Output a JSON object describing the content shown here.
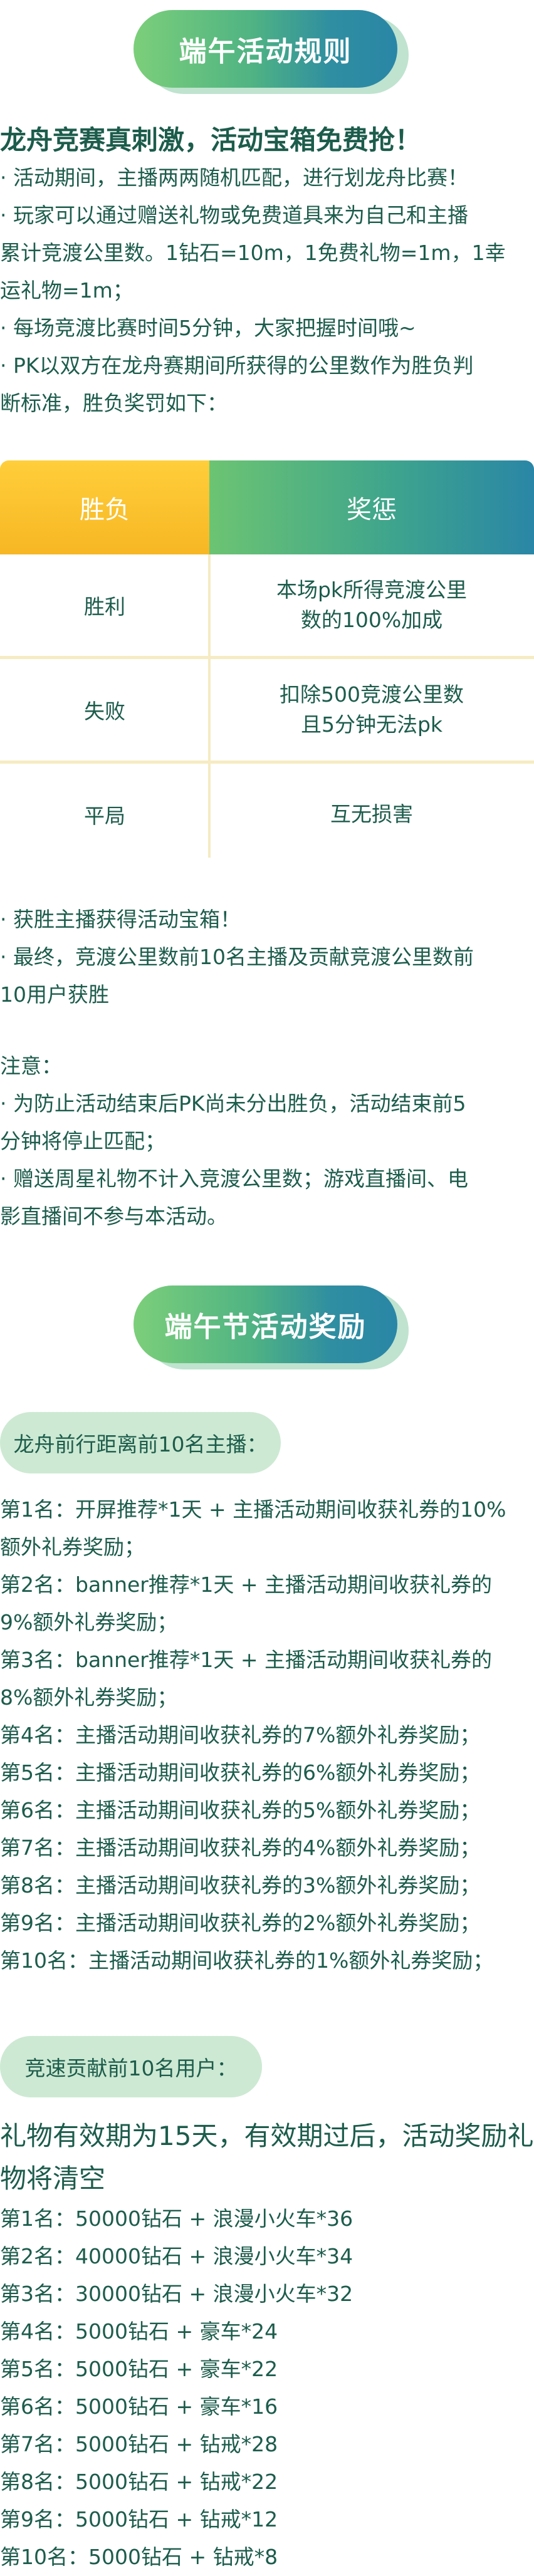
{
  "rules_title": "端午活动规则",
  "intro_heading": "龙舟竞赛真刺激，活动宝箱免费抢！",
  "rules": [
    {
      "l1": "· 活动期间，主播两两随机匹配，进行划龙舟比赛！"
    },
    {
      "l1": "· 玩家可以通过赠送礼物或免费道具来为自己和主播",
      "l2": "累计竞渡公里数。1钻石=10m，1免费礼物=1m，1幸",
      "l3": "运礼物=1m；"
    },
    {
      "l1": "· 每场竞渡比赛时间5分钟，大家把握时间哦~"
    },
    {
      "l1": "· PK以双方在龙舟赛期间所获得的公里数作为胜负判",
      "l2": "断标准，胜负奖罚如下："
    }
  ],
  "table": {
    "header_left": "胜负",
    "header_right": "奖惩",
    "rows": [
      {
        "result": "胜利",
        "reward_l1": "本场pk所得竞渡公里",
        "reward_l2": "数的100%加成"
      },
      {
        "result": "失败",
        "reward_l1": "扣除500竞渡公里数",
        "reward_l2": "且5分钟无法pk"
      },
      {
        "result": "平局",
        "reward_l1": "互无损害",
        "reward_l2": ""
      }
    ]
  },
  "after_table": [
    "· 获胜主播获得活动宝箱！",
    "· 最终，竞渡公里数前10名主播及贡献竞渡公里数前",
    "10用户获胜"
  ],
  "notice_label": "注意：",
  "notices": [
    "· 为防止活动结束后PK尚未分出胜负，活动结束前5",
    "分钟将停止匹配；",
    "· 赠送周星礼物不计入竞渡公里数；游戏直播间、电",
    "影直播间不参与本活动。"
  ],
  "rewards_title": "端午节活动奖励",
  "anchor_section": {
    "label": "龙舟前行距离前10名主播：",
    "lines": [
      "第1名：开屏推荐*1天 + 主播活动期间收获礼券的10%",
      "额外礼券奖励；",
      "第2名：banner推荐*1天 + 主播活动期间收获礼券的",
      "9%额外礼券奖励；",
      "第3名：banner推荐*1天  + 主播活动期间收获礼券的",
      "8%额外礼券奖励；",
      "第4名：主播活动期间收获礼券的7%额外礼券奖励；",
      "第5名：主播活动期间收获礼券的6%额外礼券奖励；",
      "第6名：主播活动期间收获礼券的5%额外礼券奖励；",
      "第7名：主播活动期间收获礼券的4%额外礼券奖励；",
      "第8名：主播活动期间收获礼券的3%额外礼券奖励；",
      "第9名：主播活动期间收获礼券的2%额外礼券奖励；",
      "第10名：主播活动期间收获礼券的1%额外礼券奖励；"
    ]
  },
  "user_section": {
    "label": "竞速贡献前10名用户：",
    "validity_l1": "礼物有效期为15天，有效期过后，活动奖励礼",
    "validity_l2": "物将清空",
    "lines": [
      "第1名：50000钻石 + 浪漫小火车*36",
      "第2名：40000钻石 + 浪漫小火车*34",
      "第3名：30000钻石 + 浪漫小火车*32",
      "第4名：5000钻石 + 豪车*24",
      "第5名：5000钻石 + 豪车*22",
      "第6名：5000钻石 + 豪车*16",
      "第7名：5000钻石 + 钻戒*28",
      "第8名：5000钻石 + 钻戒*22",
      "第9名：5000钻石 + 钻戒*12",
      "第10名：5000钻石 + 钻戒*8"
    ]
  }
}
